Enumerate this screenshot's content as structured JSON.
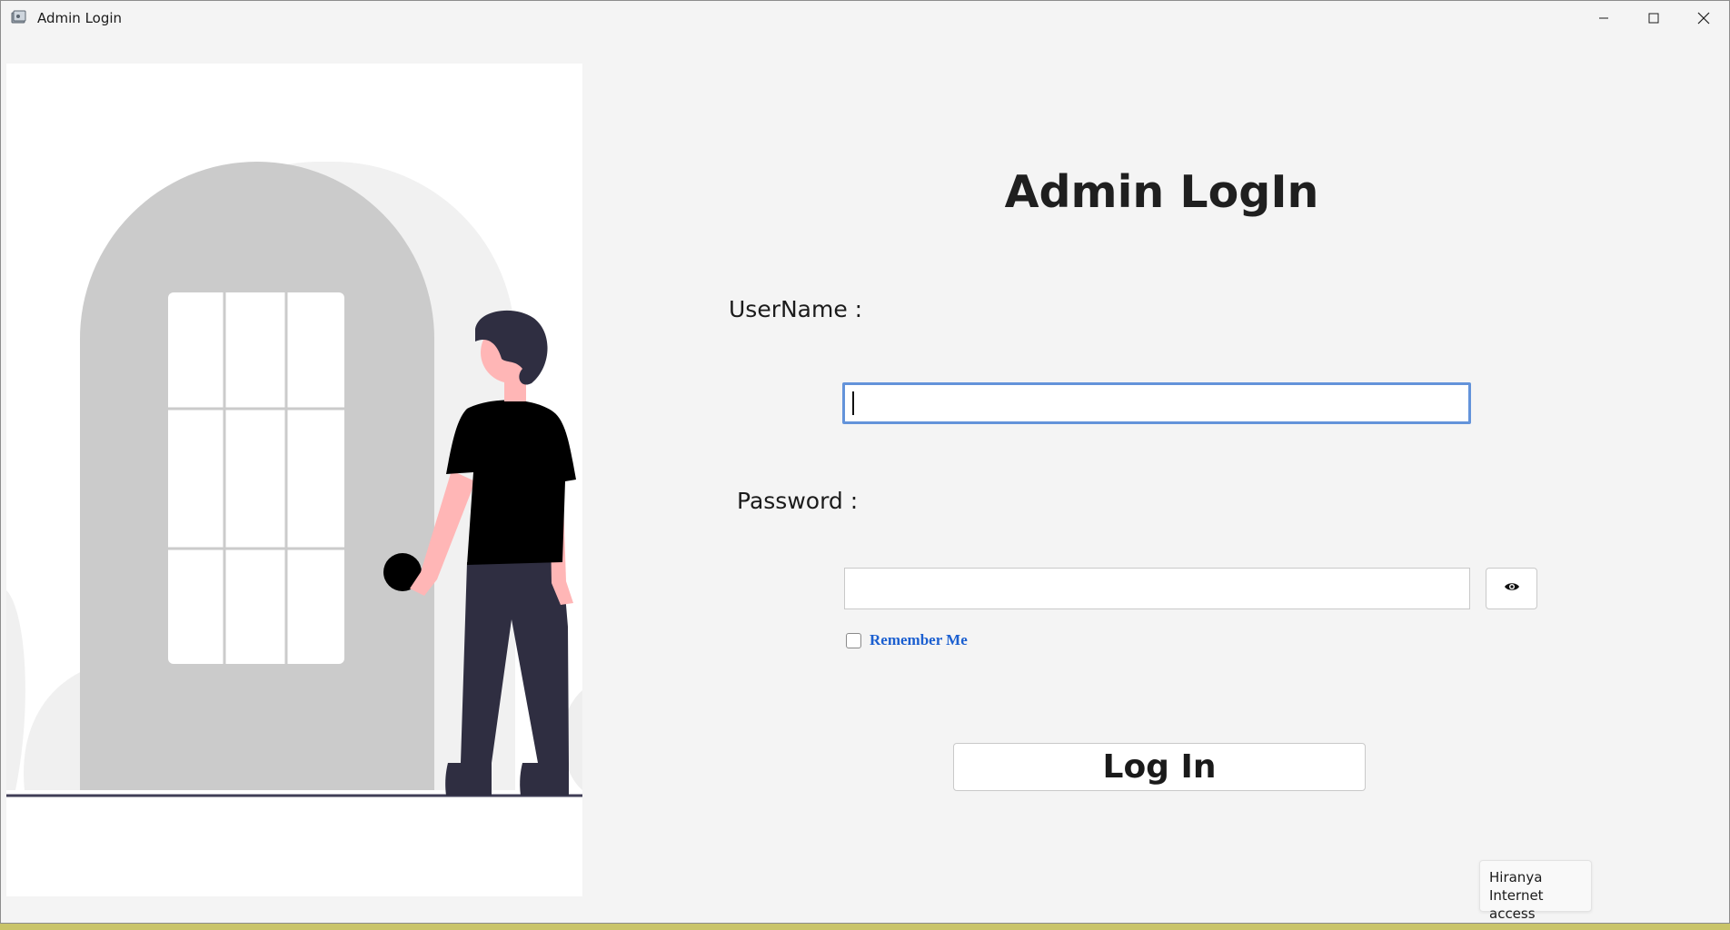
{
  "window": {
    "title": "Admin Login",
    "controls": [
      "minimize-icon",
      "maximize-icon",
      "close-icon"
    ]
  },
  "illustration": {
    "description_icon": "person-at-door-icon"
  },
  "form": {
    "heading": "Admin LogIn",
    "username_label": "UserName :",
    "username_value": "",
    "password_label": "Password :",
    "password_value": "",
    "show_password_icon": "eye-icon",
    "remember_label": "Remember Me",
    "remember_checked": false,
    "login_label": "Log In"
  },
  "tooltip": {
    "line1": "Hiranya",
    "line2": "Internet access"
  },
  "colors": {
    "focus_border": "#6393da",
    "remember_text": "#1b5fd0",
    "window_bg": "#f4f4f4"
  }
}
